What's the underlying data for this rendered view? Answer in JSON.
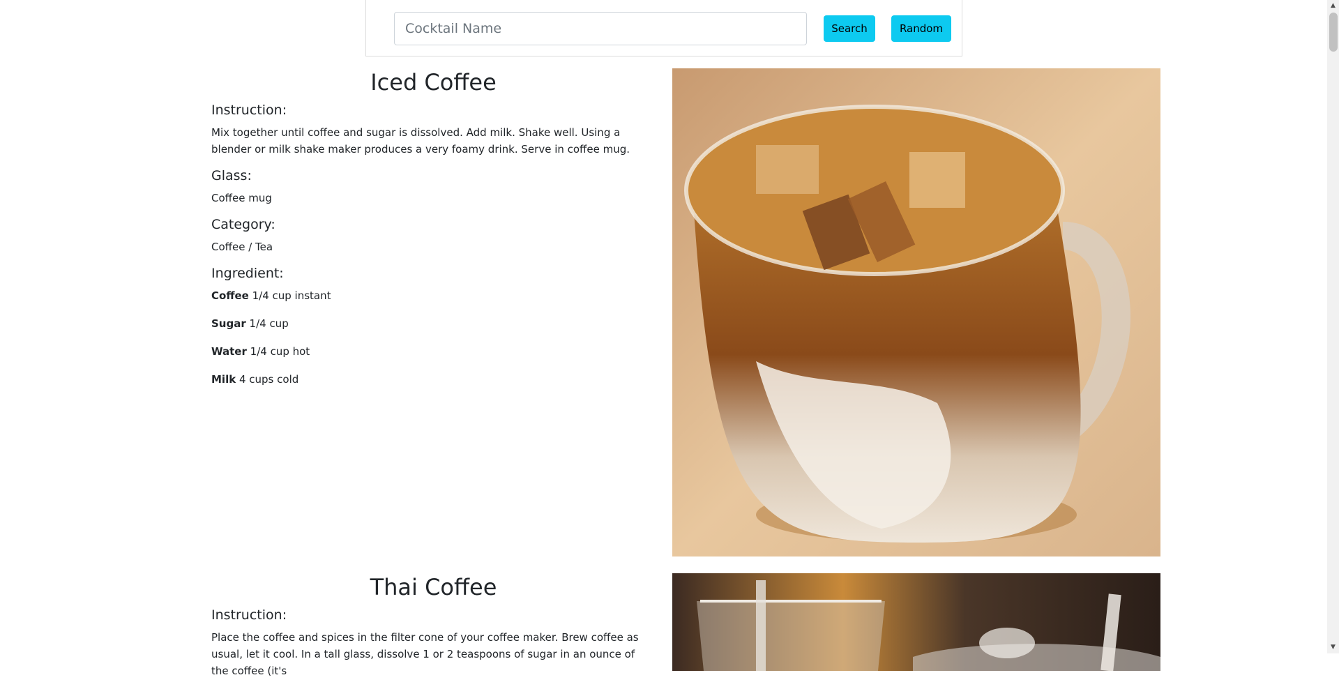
{
  "search": {
    "placeholder": "Cocktail Name",
    "value": "",
    "search_label": "Search",
    "random_label": "Random"
  },
  "drinks": [
    {
      "name": "Iced Coffee",
      "instruction_label": "Instruction:",
      "instruction": "Mix together until coffee and sugar is dissolved. Add milk. Shake well. Using a blender or milk shake maker produces a very foamy drink. Serve in coffee mug.",
      "glass_label": "Glass:",
      "glass": "Coffee mug",
      "category_label": "Category:",
      "category": "Coffee / Tea",
      "ingredient_label": "Ingredient:",
      "ingredients": [
        {
          "name": "Coffee",
          "measure": "1/4 cup instant"
        },
        {
          "name": "Sugar",
          "measure": "1/4 cup"
        },
        {
          "name": "Water",
          "measure": "1/4 cup hot"
        },
        {
          "name": "Milk",
          "measure": "4 cups cold"
        }
      ]
    },
    {
      "name": "Thai Coffee",
      "instruction_label": "Instruction:",
      "instruction": "Place the coffee and spices in the filter cone of your coffee maker. Brew coffee as usual, let it cool. In a tall glass, dissolve 1 or 2 teaspoons of sugar in an ounce of the coffee (it's"
    }
  ],
  "colors": {
    "button": "#0dcaf0",
    "text": "#212529"
  }
}
